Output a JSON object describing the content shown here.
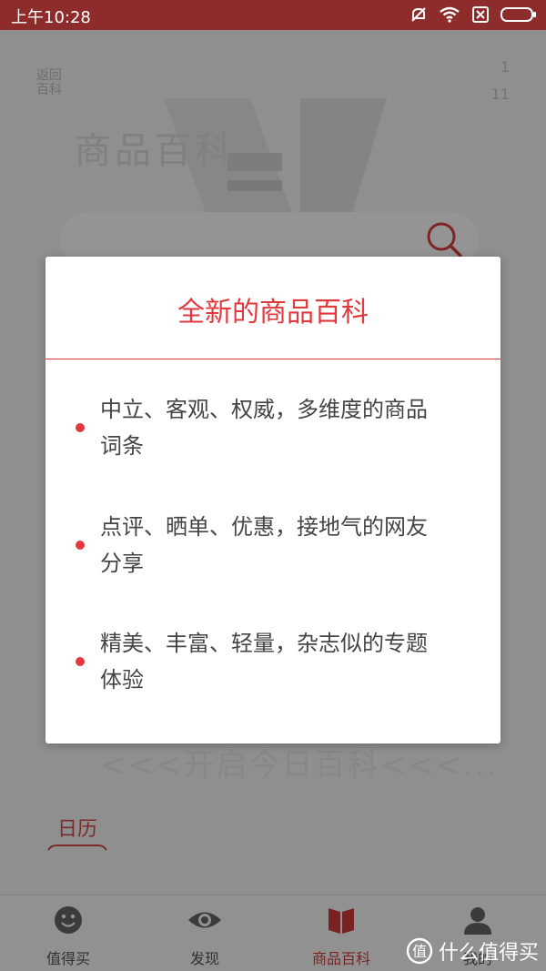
{
  "status_bar": {
    "time": "上午10:28"
  },
  "hero": {
    "mini_label_line1": "返回",
    "mini_label_line2": "百科",
    "counter_top": "1",
    "counter_bottom": "11",
    "title": "商品百科"
  },
  "search": {
    "icon": "search-icon"
  },
  "page": {
    "start_today": "<<<开启今日百科<<<...",
    "calendar_label": "日历"
  },
  "dialog": {
    "title": "全新的商品百科",
    "features": [
      {
        "line1": "中立、客观、权威，多维度的商品",
        "line2": "词条"
      },
      {
        "line1": "点评、晒单、优惠，接地气的网友",
        "line2": "分享"
      },
      {
        "line1": "精美、丰富、轻量，杂志似的专题",
        "line2": "体验"
      }
    ]
  },
  "bottom_nav": {
    "items": [
      {
        "label": "值得买",
        "icon": "smiley-icon"
      },
      {
        "label": "发现",
        "icon": "eye-icon"
      },
      {
        "label": "商品百科",
        "icon": "book-icon",
        "active": true
      },
      {
        "label": "我的",
        "icon": "user-icon"
      }
    ]
  },
  "watermark": {
    "text": "什么值得买"
  },
  "colors": {
    "accent": "#e0393e",
    "status_bar": "#8e2c2c"
  }
}
